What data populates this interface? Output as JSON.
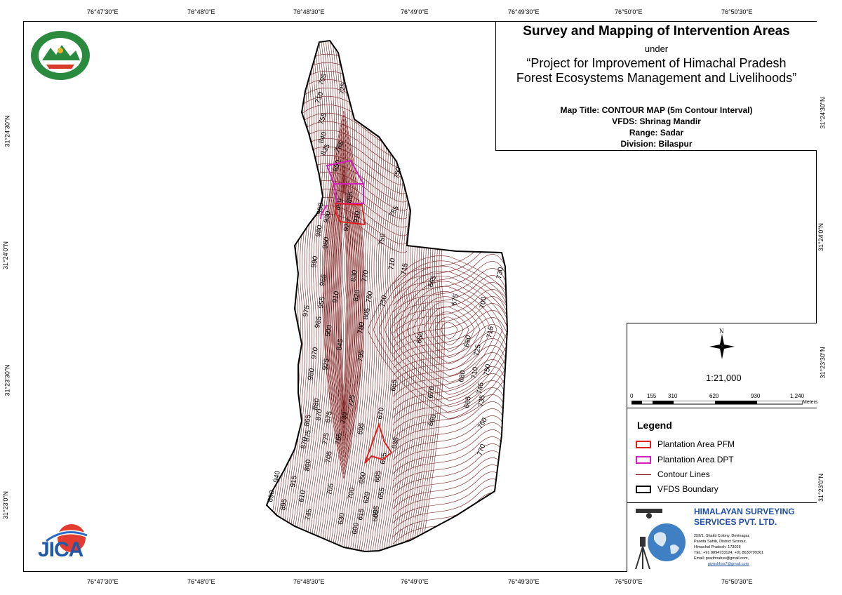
{
  "lon_labels": [
    "76°47'30\"E",
    "76°48'0\"E",
    "76°48'30\"E",
    "76°49'0\"E",
    "76°49'30\"E",
    "76°50'0\"E",
    "76°50'30\"E"
  ],
  "lat_labels": [
    "31°24'30\"N",
    "31°24'0\"N",
    "31°23'30\"N",
    "31°23'0\"N"
  ],
  "title": {
    "main": "Survey and Mapping of Intervention Areas",
    "under": "under",
    "project_line1": "“Project for Improvement of Himachal Pradesh",
    "project_line2": "Forest Ecosystems Management and Livelihoods”"
  },
  "info": {
    "map_title": "Map Title: CONTOUR MAP (5m Contour Interval)",
    "vfds": "VFDS: Shrinag Mandir",
    "range": "Range: Sadar",
    "division": "Division: Bilaspur"
  },
  "scale": {
    "north": "N",
    "ratio": "1:21,000",
    "ticks": [
      "0",
      "155",
      "310",
      "620",
      "930",
      "1,240"
    ],
    "unit": "Meters"
  },
  "legend": {
    "title": "Legend",
    "items": [
      {
        "label": "Plantation Area PFM",
        "color": "#e0201f"
      },
      {
        "label": "Plantation Area DPT",
        "color": "#d21fbf"
      },
      {
        "label": "Contour Lines",
        "color": "#7a1a1a"
      },
      {
        "label": "VFDS Boundary",
        "color": "#000000"
      }
    ]
  },
  "company": {
    "name1": "HIMALAYAN SURVEYING",
    "name2": "SERVICES PVT. LTD.",
    "addr1": "259/1, Shakti Colony, Devinagar,",
    "addr2": "Paonta Sahib, District Sirmour,",
    "addr3": "Himachal Pradesh- 173025",
    "tel": "TEL: +91 8894733124, +91 8630799361",
    "email1": "Email: prarthnahss@gmail.com,",
    "email2": "piyushhss7@gmail.com"
  },
  "logos": {
    "forest_dept_text": "वन ही जल  वन्य ही कल्याण  वन विभाग हिमाचल प्रदेश",
    "jica": "JICA"
  },
  "contour_labels": [
    "705",
    "725",
    "710",
    "755",
    "840",
    "835",
    "785",
    "850",
    "750",
    "885",
    "890",
    "950",
    "930",
    "920",
    "910",
    "755",
    "980",
    "960",
    "750",
    "710",
    "715",
    "990",
    "965",
    "830",
    "770",
    "665",
    "675",
    "730",
    "955",
    "910",
    "820",
    "760",
    "750",
    "975",
    "985",
    "805",
    "700",
    "900",
    "780",
    "660",
    "690",
    "715",
    "970",
    "845",
    "725",
    "795",
    "980",
    "925",
    "680",
    "710",
    "750",
    "665",
    "670",
    "685",
    "880",
    "745",
    "735",
    "725",
    "870",
    "675",
    "730",
    "660",
    "865",
    "760",
    "775",
    "765",
    "695",
    "670",
    "875",
    "770",
    "870",
    "705",
    "635",
    "860",
    "625",
    "650",
    "940",
    "915",
    "605",
    "655",
    "605",
    "705",
    "700",
    "620",
    "615",
    "610",
    "745",
    "690",
    "895",
    "630",
    "600",
    "605"
  ],
  "colors": {
    "contour": "#7a1a1a",
    "pfm": "#e0201f",
    "dpt": "#d21fbf",
    "boundary": "#000000",
    "company_blue": "#1f4ea3"
  }
}
